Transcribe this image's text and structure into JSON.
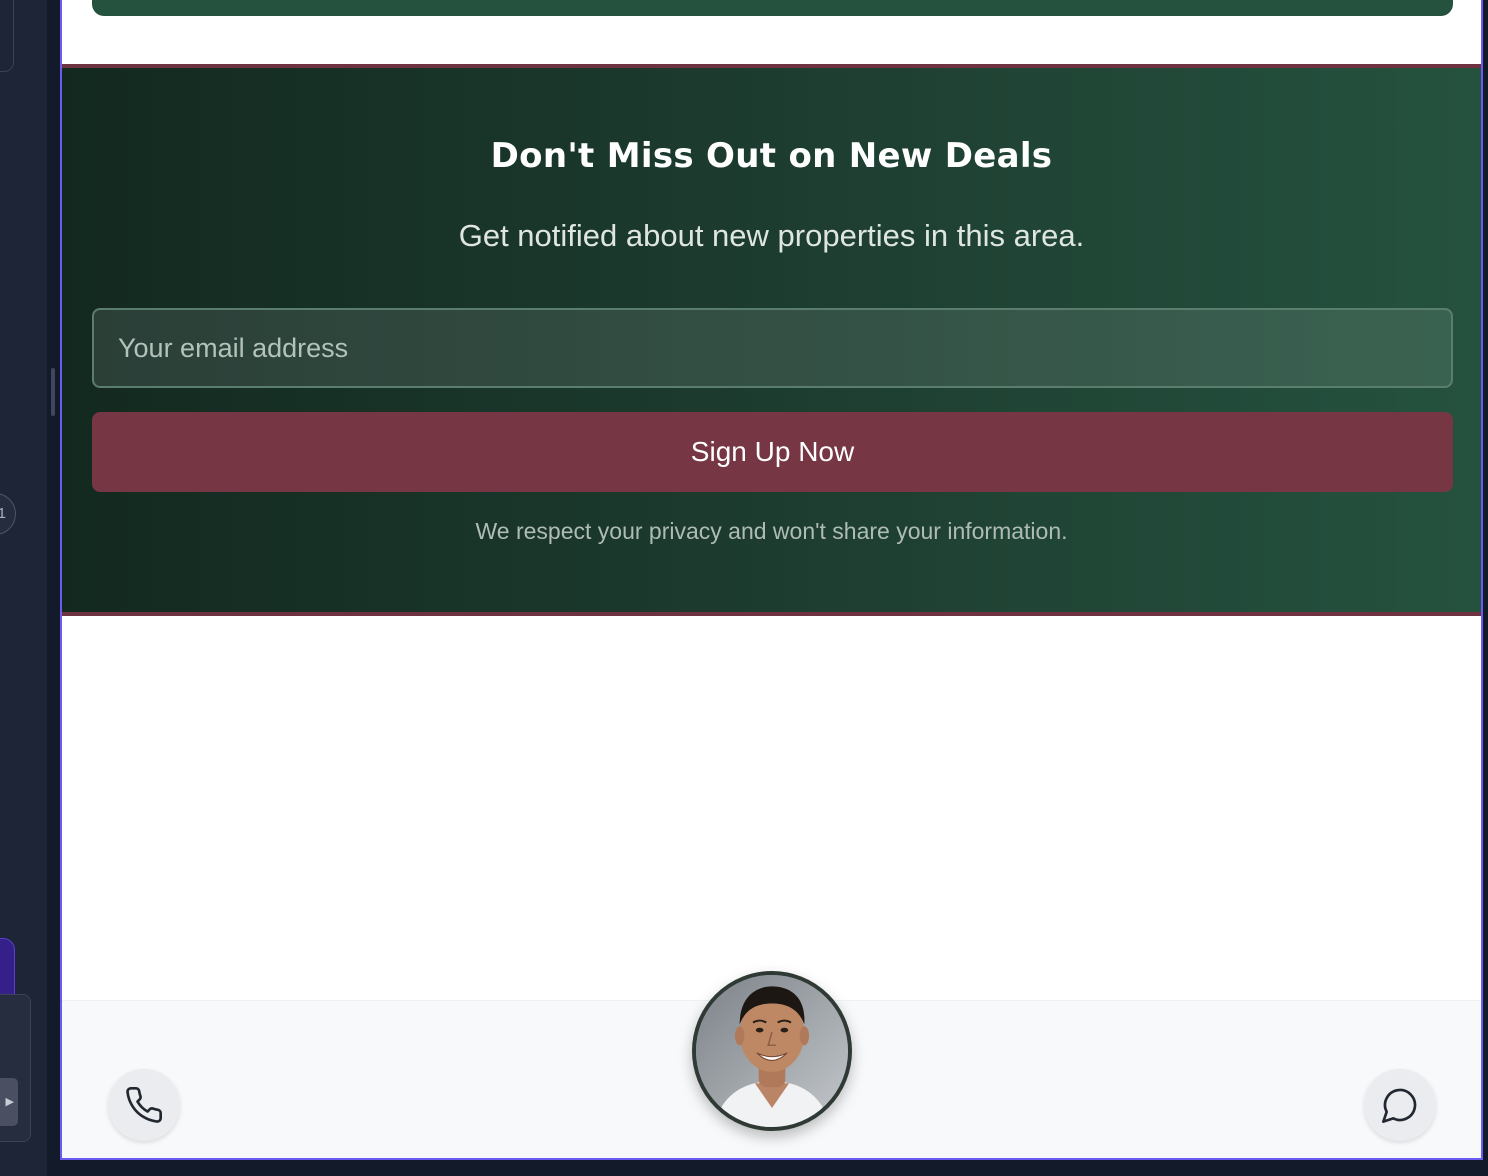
{
  "newsletter": {
    "title": "Don't Miss Out on New Deals",
    "subtitle": "Get notified about new properties in this area.",
    "email_placeholder": "Your email address",
    "email_value": "",
    "signup_label": "Sign Up Now",
    "privacy_note": "We respect your privacy and won't share your information."
  },
  "contact_bar": {
    "left_icon": "phone-icon",
    "right_icon": "chat-bubble-icon",
    "avatar": "agent-photo"
  },
  "editor_strip": {
    "badge_text": "1",
    "panel_arrow": "▶"
  },
  "colors": {
    "newsletter_gradient_start": "#132920",
    "newsletter_gradient_end": "#25523f",
    "accent_border": "#6e3240",
    "signup_button": "#763644",
    "preview_outline": "#6a5cf0"
  }
}
